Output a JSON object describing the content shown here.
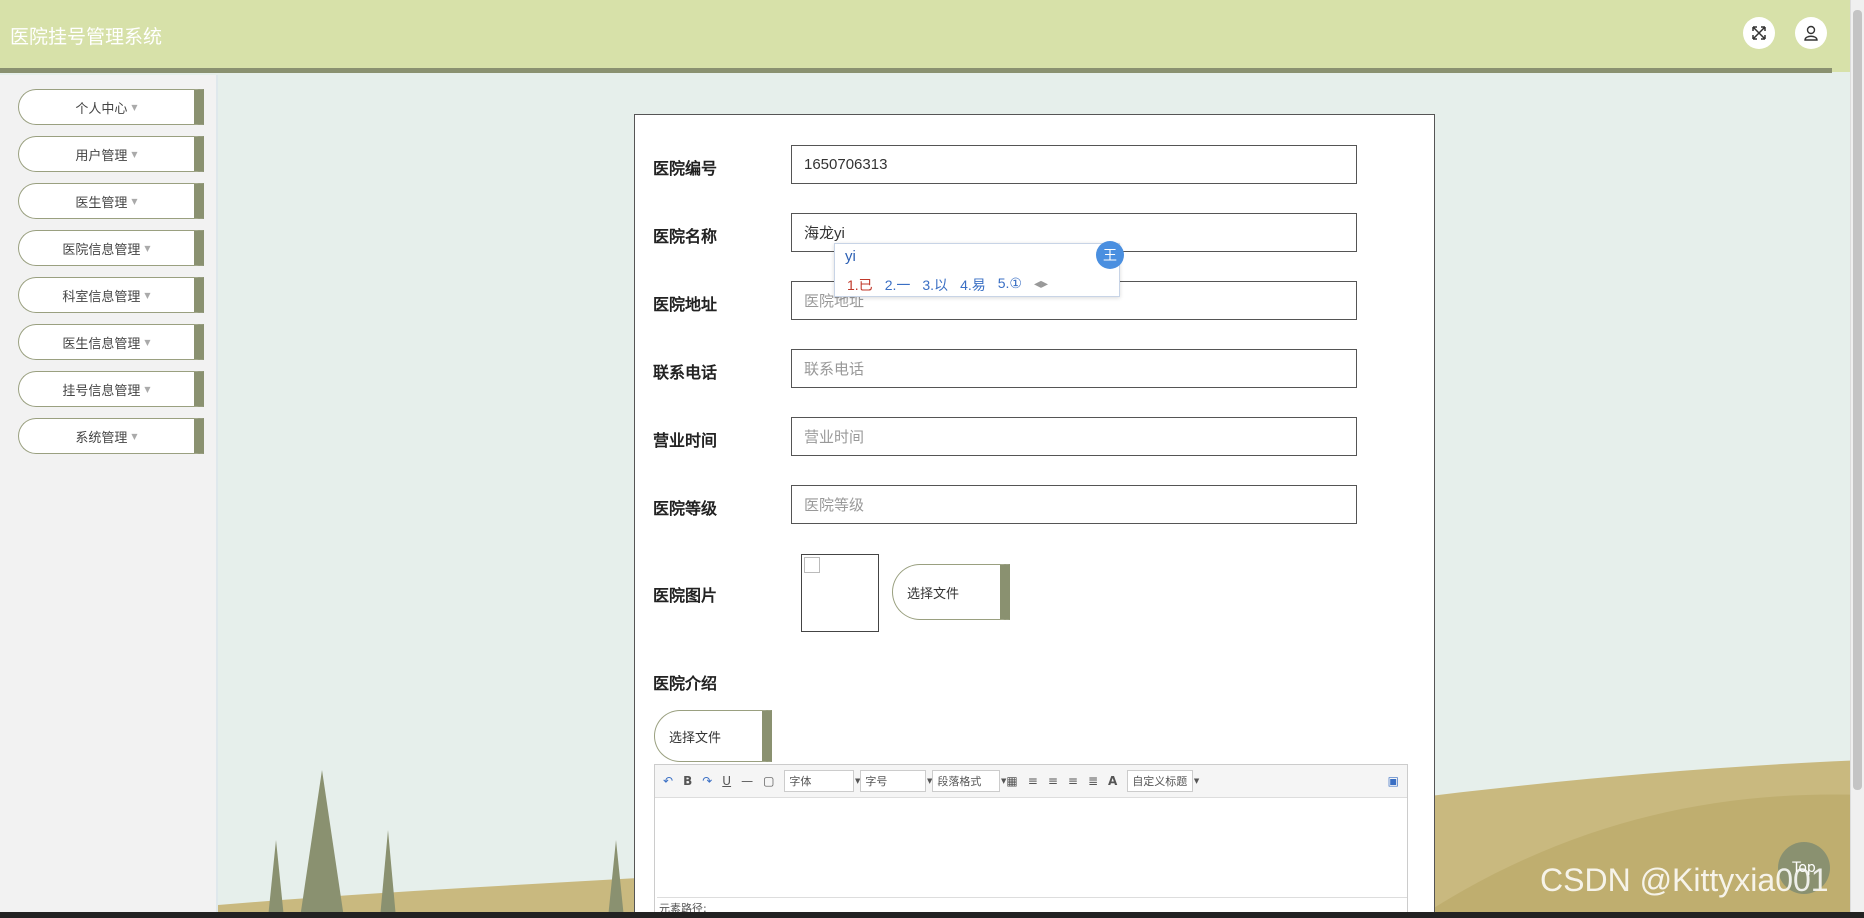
{
  "header": {
    "title": "医院挂号管理系统"
  },
  "sidebar": {
    "items": [
      {
        "label": "个人中心"
      },
      {
        "label": "用户管理"
      },
      {
        "label": "医生管理"
      },
      {
        "label": "医院信息管理"
      },
      {
        "label": "科室信息管理"
      },
      {
        "label": "医生信息管理"
      },
      {
        "label": "挂号信息管理"
      },
      {
        "label": "系统管理"
      }
    ]
  },
  "form": {
    "hospital_id": {
      "label": "医院编号",
      "value": "1650706313"
    },
    "hospital_name": {
      "label": "医院名称",
      "value": "海龙yi"
    },
    "hospital_address": {
      "label": "医院地址",
      "placeholder": "医院地址"
    },
    "phone": {
      "label": "联系电话",
      "placeholder": "联系电话"
    },
    "hours": {
      "label": "营业时间",
      "placeholder": "营业时间"
    },
    "level": {
      "label": "医院等级",
      "placeholder": "医院等级"
    },
    "image": {
      "label": "医院图片",
      "button": "选择文件"
    },
    "intro": {
      "label": "医院介绍",
      "button": "选择文件"
    }
  },
  "editor": {
    "bold": "B",
    "underline": "U",
    "font_select": "字体",
    "size_select": "字号",
    "paragraph_select": "段落格式",
    "font_color": "A",
    "custom_title": "自定义标题",
    "path_label": "元素路径:"
  },
  "ime": {
    "composition": "yi",
    "candidates": [
      "1.已",
      "2.一",
      "3.以",
      "4.易",
      "5.①"
    ],
    "badge": "王"
  },
  "top_button": "Top",
  "watermark": "CSDN @Kittyxia001"
}
